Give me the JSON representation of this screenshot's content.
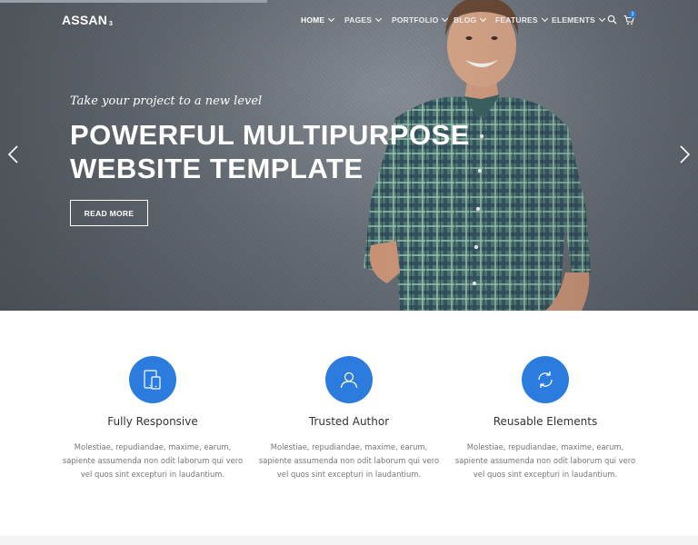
{
  "brand": {
    "name": "ASSAN",
    "version": "3"
  },
  "nav": {
    "items": [
      {
        "label": "HOME"
      },
      {
        "label": "PAGES"
      },
      {
        "label": "PORTFOLIO"
      },
      {
        "label": "BLOG"
      },
      {
        "label": "FEATURES"
      },
      {
        "label": "ELEMENTS"
      }
    ],
    "cart_count": "3"
  },
  "hero": {
    "tagline": "Take your project to a new level",
    "headline_line1": "POWERFUL MULTIPURPOSE",
    "headline_line2": "WEBSITE TEMPLATE",
    "button": "READ MORE"
  },
  "features": [
    {
      "icon": "tablet-phone-icon",
      "title": "Fully Responsive",
      "text": "Molestiae, repudiandae, maxime, earum, sapiente assumenda non odit laborum qui vero vel quos sint excepturi in laudantium."
    },
    {
      "icon": "user-icon",
      "title": "Trusted Author",
      "text": "Molestiae, repudiandae, maxime, earum, sapiente assumenda non odit laborum qui vero vel quos sint excepturi in laudantium."
    },
    {
      "icon": "refresh-icon",
      "title": "Reusable Elements",
      "text": "Molestiae, repudiandae, maxime, earum, sapiente assumenda non odit laborum qui vero vel quos sint excepturi in laudantium."
    }
  ],
  "colors": {
    "accent": "#2b7cde",
    "hero_bg": "#6f757d"
  }
}
